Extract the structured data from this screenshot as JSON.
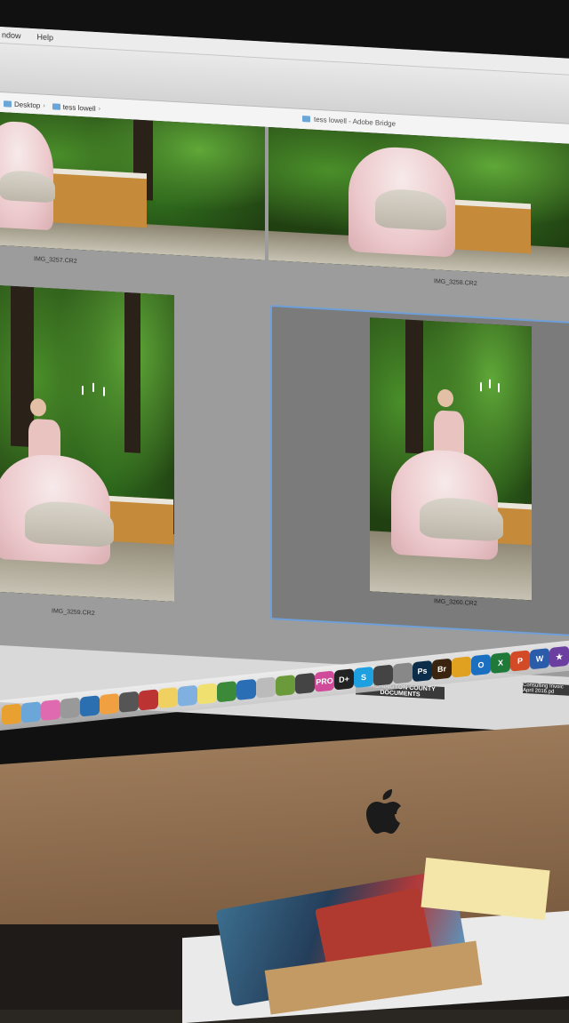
{
  "menubar": {
    "items": [
      "ndow",
      "Help"
    ]
  },
  "pathbar": {
    "crumbs": [
      "Desktop",
      "tess lowell"
    ]
  },
  "window": {
    "title": "tess lowell - Adobe Bridge"
  },
  "thumbnails": [
    {
      "filename": "IMG_3257.CR2"
    },
    {
      "filename": "IMG_3258.CR2"
    },
    {
      "filename": "IMG_3259.CR2"
    },
    {
      "filename": "IMG_3260.CR2"
    }
  ],
  "desktop_items": [
    {
      "label": "WASHINGTON COUNTY DOCUMENTS"
    },
    {
      "label": "Consulting Invoic April 2016.pd"
    }
  ],
  "dock": {
    "icons": [
      {
        "name": "chrome-icon",
        "color": "#e8a030",
        "text": ""
      },
      {
        "name": "preview-icon",
        "color": "#6aa6d8",
        "text": ""
      },
      {
        "name": "itunes-icon",
        "color": "#e06ab0",
        "text": ""
      },
      {
        "name": "xcode-icon",
        "color": "#999999",
        "text": ""
      },
      {
        "name": "quicktime-icon",
        "color": "#2c6fb0",
        "text": ""
      },
      {
        "name": "photos-icon",
        "color": "#f0a040",
        "text": ""
      },
      {
        "name": "camera-icon",
        "color": "#555555",
        "text": ""
      },
      {
        "name": "photo-booth-icon",
        "color": "#bb3333",
        "text": ""
      },
      {
        "name": "notes-icon",
        "color": "#f0d060",
        "text": ""
      },
      {
        "name": "comic-icon",
        "color": "#7fb0e0",
        "text": ""
      },
      {
        "name": "stickies-icon",
        "color": "#f0e070",
        "text": ""
      },
      {
        "name": "pen-icon",
        "color": "#3a8a3a",
        "text": ""
      },
      {
        "name": "safari-icon",
        "color": "#2a6fb6",
        "text": ""
      },
      {
        "name": "trash-can-icon",
        "color": "#bbbbbb",
        "text": ""
      },
      {
        "name": "game-icon",
        "color": "#6a9a3a",
        "text": ""
      },
      {
        "name": "music-icon",
        "color": "#444444",
        "text": ""
      },
      {
        "name": "pro-icon",
        "color": "#d04a9a",
        "text": "PRO"
      },
      {
        "name": "dplus-icon",
        "color": "#222222",
        "text": "D+"
      },
      {
        "name": "skype-icon",
        "color": "#1ea0e0",
        "text": "S"
      },
      {
        "name": "globe-icon",
        "color": "#444444",
        "text": ""
      },
      {
        "name": "link-icon",
        "color": "#888888",
        "text": ""
      },
      {
        "name": "photoshop-icon",
        "color": "#0b2d4a",
        "text": "Ps"
      },
      {
        "name": "bridge-icon",
        "color": "#3a2410",
        "text": "Br"
      },
      {
        "name": "chrome-2-icon",
        "color": "#e0a020",
        "text": ""
      },
      {
        "name": "outlook-icon",
        "color": "#1a6fc0",
        "text": "O"
      },
      {
        "name": "excel-icon",
        "color": "#1f7a3a",
        "text": "X"
      },
      {
        "name": "powerpoint-icon",
        "color": "#d24a26",
        "text": "P"
      },
      {
        "name": "word-icon",
        "color": "#2a5caa",
        "text": "W"
      },
      {
        "name": "star-icon",
        "color": "#6b3fa0",
        "text": "★"
      }
    ]
  }
}
